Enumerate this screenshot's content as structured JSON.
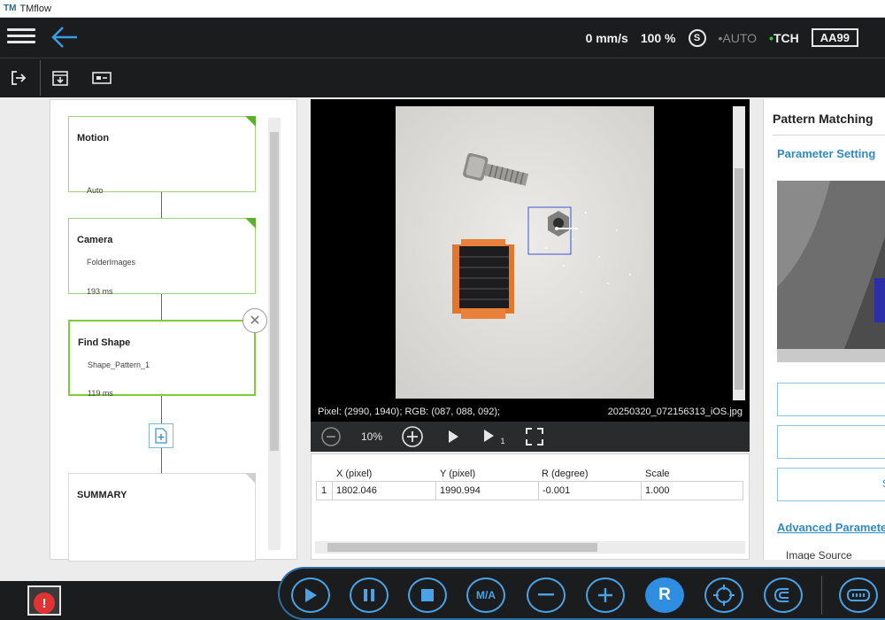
{
  "app": {
    "title": "TMflow",
    "logo": "TM"
  },
  "header": {
    "speed": "0 mm/s",
    "percent": "100 %",
    "safety_icon": "S",
    "mode_auto": "AUTO",
    "mode_tch": "TCH",
    "robot_id": "AA99",
    "dot": "•"
  },
  "flow": {
    "nodes": [
      {
        "title": "Motion",
        "sub": "Auto"
      },
      {
        "title": "Camera",
        "sub": "FolderImages",
        "time": "193 ms"
      },
      {
        "title": "Find Shape",
        "sub": "Shape_Pattern_1",
        "time": "119 ms"
      },
      {
        "title": "SUMMARY"
      }
    ]
  },
  "viewer": {
    "pixel_info": "Pixel: (2990, 1940); RGB: (087, 088, 092);",
    "filename": "20250320_072156313_iOS.jpg",
    "zoom": "10%",
    "step_sub": "1"
  },
  "results": {
    "columns": [
      "X (pixel)",
      "Y (pixel)",
      "R (degree)",
      "Scale"
    ],
    "rows": [
      {
        "index": "1",
        "x": "1802.046",
        "y": "1990.994",
        "r": "-0.001",
        "scale": "1.000"
      }
    ]
  },
  "right_panel": {
    "title": "Pattern Matching",
    "param_section": "Parameter Setting",
    "advanced_section": "Advanced Parameter",
    "image_source": "Image Source",
    "button3_partial": "S"
  },
  "controls": {
    "ma_label": "M/A",
    "r_label": "R"
  },
  "colors": {
    "accent_blue": "#2f8ee0",
    "node_green": "#5cb02a",
    "alert_red": "#e23232",
    "header_bg": "#1b1c1e"
  }
}
